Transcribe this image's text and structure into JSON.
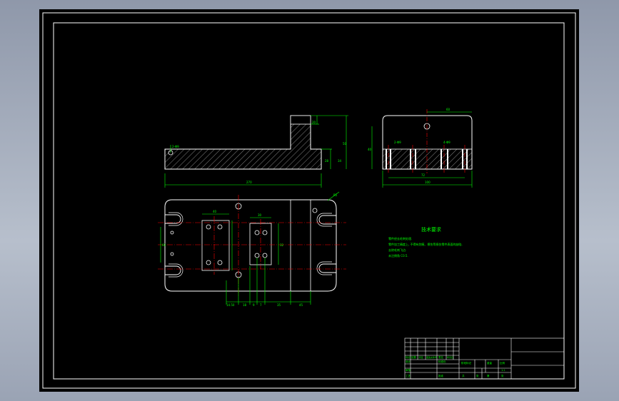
{
  "drawing": {
    "title": "技术要求",
    "requirements": [
      "零件经去毛刺处理.",
      "零件加工精度上, 不得有划痕、擦伤等损伤零件表面的缺陷.",
      "去除毛刺飞边.",
      "未注倒角 C0.5."
    ],
    "front_view_dims": [
      "2-Φ9",
      "270",
      "50",
      "28",
      "20",
      "34"
    ],
    "side_view_dims": [
      "60",
      "2-Φ9",
      "4-Φ9",
      "72",
      "100",
      "40"
    ],
    "plan_view_dims": [
      "R5",
      "40",
      "30",
      "32",
      "60",
      "14.50",
      "18",
      "9",
      "7",
      "35",
      "45"
    ],
    "title_block": {
      "labels": [
        "标记",
        "处数",
        "分区",
        "更改文件号",
        "签名",
        "年月日",
        "设计",
        "标准化",
        "阶段标记",
        "重量",
        "比例",
        "审核",
        "工艺",
        "批准",
        "共",
        "张",
        "第",
        "张"
      ],
      "scale": "1:1"
    }
  },
  "colors": {
    "background": "#000000",
    "frame": "#ffffff",
    "dimension": "#00ff00",
    "center_line": "#ff0000",
    "hatch": "#e0e0e0"
  }
}
